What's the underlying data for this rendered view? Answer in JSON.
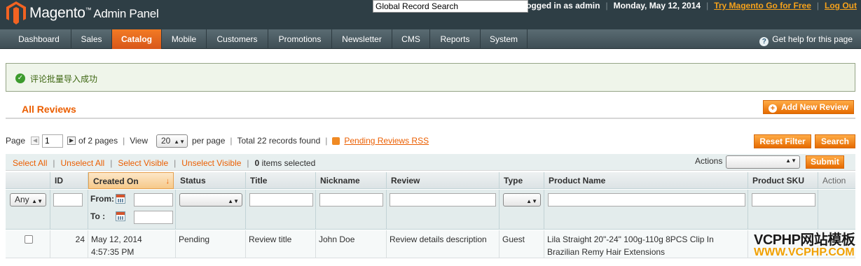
{
  "header": {
    "logo_text": "Magento",
    "logo_trademark": "™",
    "logo_subtitle": "Admin Panel",
    "global_search_value": "Global Record Search",
    "logged_in": "Logged in as admin",
    "date": "Monday, May 12, 2014",
    "try_link": "Try Magento Go for Free",
    "logout_link": "Log Out"
  },
  "nav": {
    "items": [
      "Dashboard",
      "Sales",
      "Catalog",
      "Mobile",
      "Customers",
      "Promotions",
      "Newsletter",
      "CMS",
      "Reports",
      "System"
    ],
    "active": "Catalog",
    "help": "Get help for this page"
  },
  "message": {
    "text": "评论批量导入成功"
  },
  "page": {
    "title": "All Reviews",
    "add_button": "Add New Review",
    "reset_filter": "Reset Filter",
    "search": "Search"
  },
  "pager": {
    "page_label": "Page",
    "page_value": "1",
    "of_pages": "of 2 pages",
    "view_label": "View",
    "per_page_value": "20",
    "per_page_label": "per page",
    "total": "Total 22 records found",
    "rss_link": "Pending Reviews RSS"
  },
  "massaction": {
    "select_all": "Select All",
    "unselect_all": "Unselect All",
    "select_visible": "Select Visible",
    "unselect_visible": "Unselect Visible",
    "selected_count": "0",
    "selected_label": "items selected",
    "actions_label": "Actions",
    "submit": "Submit"
  },
  "grid": {
    "columns": [
      "ID",
      "Created On",
      "Status",
      "Title",
      "Nickname",
      "Review",
      "Type",
      "Product Name",
      "Product SKU",
      "Action"
    ],
    "sorted_column": "Created On",
    "filters": {
      "any": "Any",
      "from": "From:",
      "to": "To :"
    },
    "rows": [
      {
        "id": "24",
        "created_on": "May 12, 2014 4:57:35 PM",
        "status": "Pending",
        "title": "Review title",
        "nickname": "John Doe",
        "review": "Review details description",
        "type": "Guest",
        "product_name": "Lila Straight 20\"-24\" 100g-110g 8PCS Clip In Brazilian Remy Hair Extensions",
        "product_sku": "",
        "action": ""
      }
    ]
  },
  "watermark": {
    "line1": "VCPHP网站模板",
    "line2": "WWW.VCPHP.COM"
  },
  "colors": {
    "header_bg": "#2e3e45",
    "accent": "#eb5e00",
    "link_orange": "#f6a21b",
    "success_bg": "#eff5ea"
  }
}
